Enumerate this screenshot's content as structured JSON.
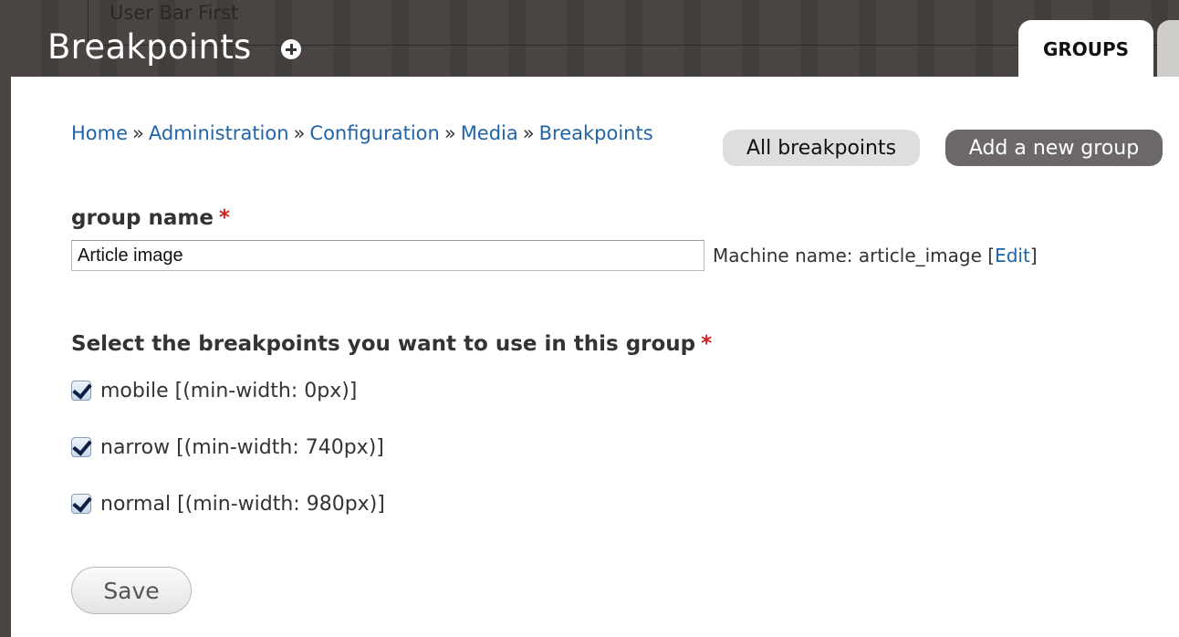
{
  "header": {
    "user_bar_label": "User Bar First",
    "page_title": "Breakpoints",
    "tabs": [
      {
        "label": "GROUPS",
        "active": true
      }
    ]
  },
  "breadcrumb": [
    {
      "label": "Home"
    },
    {
      "label": "Administration"
    },
    {
      "label": "Configuration"
    },
    {
      "label": "Media"
    },
    {
      "label": "Breakpoints"
    }
  ],
  "breadcrumb_separator": "»",
  "actions": {
    "all_breakpoints": "All breakpoints",
    "add_group": "Add a new group"
  },
  "form": {
    "group_name_label": "group name",
    "required_marker": "*",
    "group_name_value": "Article image",
    "machine_name_prefix": "Machine name: article_image [",
    "machine_name_edit": "Edit",
    "machine_name_suffix": "]",
    "breakpoints_label": "Select the breakpoints you want to use in this group",
    "breakpoints": [
      {
        "label": "mobile [(min-width: 0px)]",
        "checked": true
      },
      {
        "label": "narrow [(min-width: 740px)]",
        "checked": true
      },
      {
        "label": "normal [(min-width: 980px)]",
        "checked": true
      }
    ],
    "save_label": "Save"
  },
  "colors": {
    "header_bg": "#4a4542",
    "link": "#1f63a8",
    "required": "#d02020",
    "primary_button": "#6b6867"
  }
}
